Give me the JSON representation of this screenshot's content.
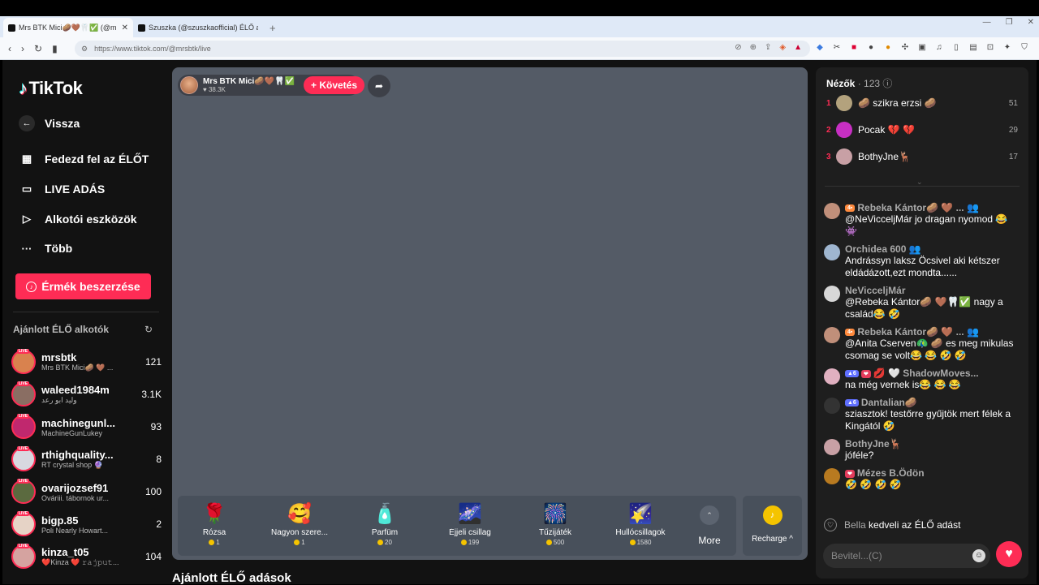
{
  "browser": {
    "tabs": [
      {
        "title": "Mrs BTK Mici🥔🤎🦷✅ (@m",
        "close": "✕"
      },
      {
        "title": "Szuszka (@szuszkaofficial) ÉLŐ adás",
        "close": ""
      }
    ],
    "new_tab": "+",
    "window_controls": [
      "—",
      "❐",
      "✕"
    ],
    "url": "https://www.tiktok.com/@mrsbtk/live"
  },
  "sidebar": {
    "logo": "TikTok",
    "back_label": "Vissza",
    "menu": [
      {
        "label": "Fedezd fel az ÉLŐT",
        "icon": "calendar-live-icon"
      },
      {
        "label": "LIVE ADÁS",
        "icon": "camera-icon"
      },
      {
        "label": "Alkotói eszközök",
        "icon": "creator-tools-icon"
      },
      {
        "label": "Több",
        "icon": "more-dots-icon"
      }
    ],
    "coins_button": "Érmék beszerzése",
    "recommended_title": "Ajánlott ÉLŐ alkotók",
    "recommended": [
      {
        "name": "mrsbtk",
        "sub": "Mrs BTK Mici🥔 🤎 ...",
        "count": "121",
        "color": "#d9824e"
      },
      {
        "name": "waleed1984m",
        "sub": "وليد ابو رعد",
        "count": "3.1K",
        "color": "#8a6e63"
      },
      {
        "name": "machinegunl...",
        "sub": "MachineGunLukey",
        "count": "93",
        "color": "#c0286e"
      },
      {
        "name": "rthighquality...",
        "sub": "RT crystal shop 🔮",
        "count": "8",
        "color": "#d8d8e0"
      },
      {
        "name": "ovarijozsef91",
        "sub": "Ováriii. tábornok ur...",
        "count": "100",
        "color": "#5b6a3f"
      },
      {
        "name": "bigp.85",
        "sub": "Poli Nearly Howart...",
        "count": "2",
        "color": "#e6d3c6"
      },
      {
        "name": "kinza_t05",
        "sub": "❤️Kinza ❤️ 𝚛𝚊𝚓𝚙𝚞𝚝...",
        "count": "104",
        "color": "#d5a3a0"
      }
    ]
  },
  "host": {
    "name": "Mrs BTK Mici🥔🤎🦷✅",
    "likes": "♥ 38.3K",
    "follow": "+ Követés"
  },
  "gifts": [
    {
      "icon": "🌹",
      "name": "Rózsa",
      "price": "1"
    },
    {
      "icon": "🥰",
      "name": "Nagyon szere...",
      "price": "1"
    },
    {
      "icon": "🧴",
      "name": "Parfüm",
      "price": "20"
    },
    {
      "icon": "🌌",
      "name": "Éjjeli csillag",
      "price": "199"
    },
    {
      "icon": "🎆",
      "name": "Tűzijáték",
      "price": "500"
    },
    {
      "icon": "🌠",
      "name": "Hullócsillagok",
      "price": "1580"
    }
  ],
  "more_label": "More",
  "recharge_label": "Recharge ^",
  "recommended_heading": "Ajánlott ÉLŐ adások",
  "viewers": {
    "title": "Nézők",
    "count": "· 123",
    "top": [
      {
        "rank": "1",
        "name": "🥔 szikra erzsi 🥔",
        "score": "51",
        "color": "#b3a27d"
      },
      {
        "rank": "2",
        "name": "Pocak 💔 💔",
        "score": "29",
        "color": "#c72fc3"
      },
      {
        "rank": "3",
        "name": "BothyJne🦌",
        "score": "17",
        "color": "#c8a0a5"
      }
    ]
  },
  "chat": [
    {
      "badges": [
        "orange"
      ],
      "name": "Rebeka Kántor🥔 🤎 ... 👥",
      "text": "@NeVicceljMár jo dragan nyomod 😂 👾",
      "color": "#c08f7a"
    },
    {
      "badges": [],
      "name": "Orchidea 600 👥",
      "text": "Andrássyn laksz Öcsivel aki kétszer eldádázott,ezt mondta......",
      "color": "#9fb6d0"
    },
    {
      "badges": [],
      "name": "NeVicceljMár",
      "text": "@Rebeka Kántor🥔 🤎🦷✅ nagy a család😂 🤣",
      "color": "#d7d7d7"
    },
    {
      "badges": [
        "orange"
      ],
      "name": "Rebeka Kántor🥔 🤎 ... 👥",
      "text": "@Anita Cserven🦚 🥔 es meg mikulas csomag se volt😂 😂 🤣 🤣",
      "color": "#c08f7a"
    },
    {
      "badges": [
        "blue",
        "red"
      ],
      "name": "💋 🤍 ShadowMoves...",
      "text": "na még vernek is😂 😂 😂",
      "color": "#e0b0c0"
    },
    {
      "badges": [
        "blue"
      ],
      "name": "Dantalian🥔",
      "text": "sziasztok! testőrre gyűjtök mert félek a Kingától 🤣",
      "color": "#333333"
    },
    {
      "badges": [],
      "name": "BothyJne🦌",
      "text": "jóféle?",
      "color": "#c8a0a5"
    },
    {
      "badges": [
        "red"
      ],
      "name": "Mézes B.Ödön",
      "text": "🤣 🤣 🤣 🤣",
      "color": "#b87a20"
    }
  ],
  "badge_labels": {
    "orange": "4▪",
    "blue": "▲6",
    "red": "❤"
  },
  "like_line": {
    "name": "Bella",
    "text": "kedveli az ÉLŐ adást"
  },
  "input_placeholder": "Bevitel...(C)"
}
